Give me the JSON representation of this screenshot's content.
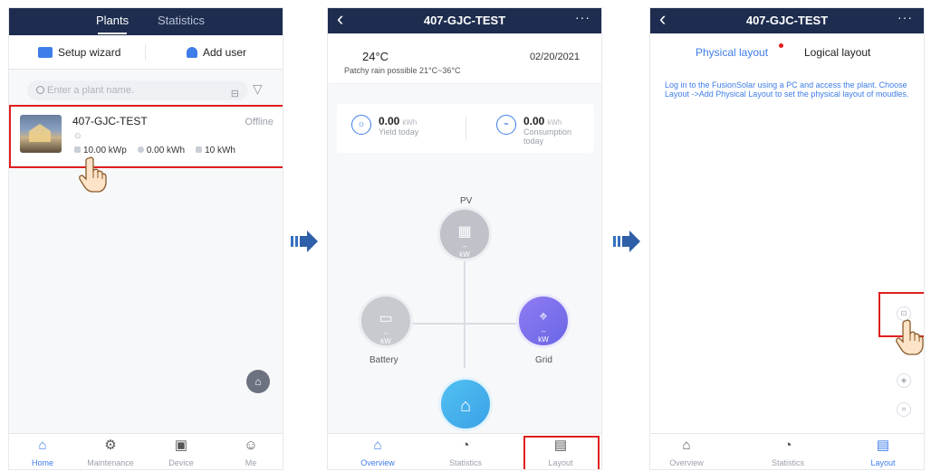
{
  "screen1": {
    "tabs": [
      "Plants",
      "Statistics"
    ],
    "setup_wizard": "Setup wizard",
    "add_user": "Add user",
    "search_placeholder": "Enter a plant name.",
    "plant": {
      "name": "407-GJC-TEST",
      "status": "Offline",
      "capacity": "10.00 kWp",
      "energy": "0.00 kWh",
      "storage": "10 kWh"
    },
    "nav": [
      "Home",
      "Maintenance",
      "Device",
      "Me"
    ]
  },
  "screen2": {
    "title": "407-GJC-TEST",
    "temperature": "24°C",
    "weather": "Patchy rain possible 21°C~36°C",
    "date": "02/20/2021",
    "yield": {
      "value": "0.00",
      "unit": "kWh",
      "label": "Yield today"
    },
    "consumption": {
      "value": "0.00",
      "unit": "kWh",
      "label": "Consumption today"
    },
    "flow": {
      "pv_label": "PV",
      "pv_value": "--",
      "pv_unit": "kW",
      "battery_label": "Battery",
      "battery_value": "--",
      "battery_unit": "kW",
      "grid_label": "Grid",
      "grid_value": "--",
      "grid_unit": "kW"
    },
    "nav": [
      "Overview",
      "Statistics",
      "Layout"
    ]
  },
  "screen3": {
    "title": "407-GJC-TEST",
    "tab_physical": "Physical layout",
    "tab_logical": "Logical layout",
    "hint": "Log in to the FusionSolar using a PC and access the plant. Choose Layout ->Add Physical Layout to set the physical layout of moudles.",
    "nav": [
      "Overview",
      "Statistics",
      "Layout"
    ]
  },
  "colors": {
    "header": "#1e2d4f",
    "accent": "#3f7de8",
    "highlight": "#e01e1e"
  }
}
